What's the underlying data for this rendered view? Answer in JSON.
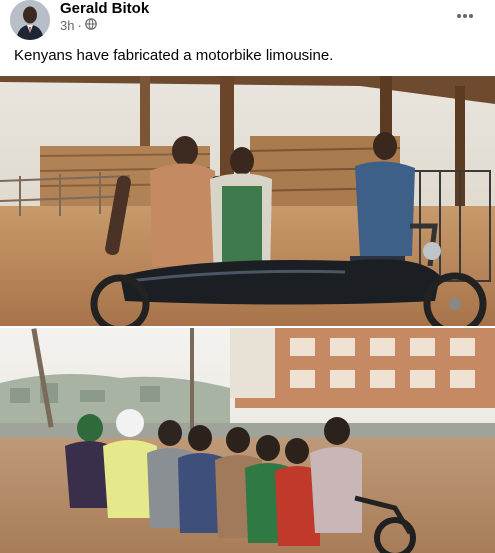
{
  "post": {
    "author": "Gerald Bitok",
    "time": "3h",
    "separator": "·",
    "audience_icon": "globe-icon",
    "more_icon": "more-options-icon",
    "text": "Kenyans have fabricated a motorbike limousine."
  },
  "photos": [
    {
      "subject": "workshop-photo"
    },
    {
      "subject": "road-photo"
    }
  ],
  "colors": {
    "author_text": "#050505",
    "meta_text": "#65676b",
    "background": "#ffffff"
  }
}
